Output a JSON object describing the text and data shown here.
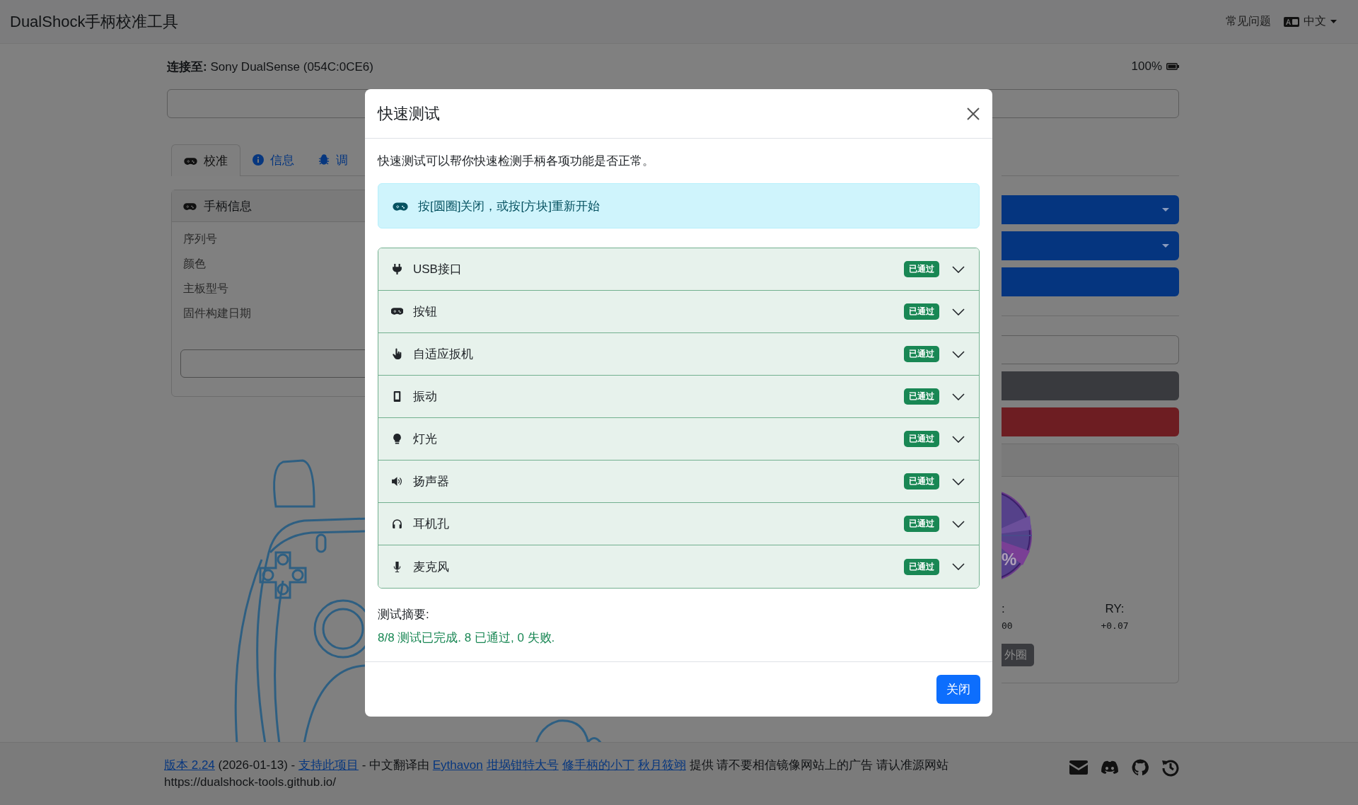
{
  "navbar": {
    "brand": "DualShock手柄校准工具",
    "faq": "常见问题",
    "language": "中文"
  },
  "connection": {
    "label": "**连接至:** Sony DualSense (054C:0CE6)",
    "battery": "100%"
  },
  "tabs": [
    {
      "label": "校准",
      "selected": true
    },
    {
      "label": "信息",
      "selected": false
    },
    {
      "label": "调",
      "selected": false
    }
  ],
  "info_card": {
    "title": "手柄信息",
    "rows": [
      "序列号",
      "颜色",
      "主板型号",
      "固件构建日期"
    ]
  },
  "stick_panel": {
    "percent": "%",
    "left_label": ":",
    "left_value": "00",
    "right_label": "RY:",
    "right_value": "+0.07",
    "button": "外圈"
  },
  "modal": {
    "title": "快速测试",
    "intro": "快速测试可以帮你快速检测手柄各项功能是否正常。",
    "alert": "按[圆圈]关闭，或按[方块]重新开始",
    "tests": [
      {
        "label": "USB接口",
        "passed": true,
        "badge": "已通过",
        "expanded": false
      },
      {
        "label": "按钮",
        "passed": true,
        "badge": "已通过",
        "expanded": false
      },
      {
        "label": "自适应扳机",
        "passed": true,
        "badge": "已通过",
        "expanded": false
      },
      {
        "label": "振动",
        "passed": true,
        "badge": "已通过",
        "expanded": false
      },
      {
        "label": "灯光",
        "passed": true,
        "badge": "已通过",
        "expanded": false
      },
      {
        "label": "扬声器",
        "passed": true,
        "badge": "已通过",
        "expanded": false
      },
      {
        "label": "耳机孔",
        "passed": true,
        "badge": "已通过",
        "expanded": false
      },
      {
        "label": "麦克风",
        "passed": true,
        "badge": "已通过",
        "expanded": false
      }
    ],
    "summary_title": "测试摘要:",
    "summary": "8/8 测试已完成. 8 已通过, 0 失败.",
    "close_button": "关闭"
  },
  "footer": {
    "segments": [
      {
        "text": "版本 2.24",
        "link": true
      },
      {
        "text": " (2026-01-13) - ",
        "link": false
      },
      {
        "text": "支持此项目",
        "link": true
      },
      {
        "text": " - 中文翻译由 ",
        "link": false
      },
      {
        "text": "Eythavon",
        "link": true
      },
      {
        "text": "坩埚钳特大号",
        "link": true
      },
      {
        "text": "修手柄的小丁",
        "link": true
      },
      {
        "text": "秋月筱翊",
        "link": true
      },
      {
        "text": " 提供 请不要相信镜像网站上的广告 请认准源网站",
        "link": false
      }
    ],
    "url": "https://dualshock-tools.github.io/"
  }
}
